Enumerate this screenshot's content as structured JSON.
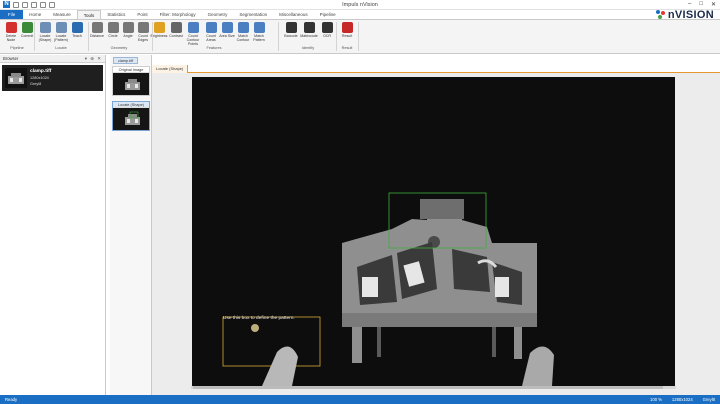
{
  "window": {
    "title": "Impuls nVision",
    "brand": "nVISION"
  },
  "menu": {
    "tabs": [
      {
        "label": "File"
      },
      {
        "label": "Home"
      },
      {
        "label": "Measure"
      },
      {
        "label": "Tools"
      },
      {
        "label": "Statistics"
      },
      {
        "label": "Point"
      },
      {
        "label": "Filter: Morphology"
      },
      {
        "label": "Geometry"
      },
      {
        "label": "Segmentation"
      },
      {
        "label": "Miscellaneous"
      },
      {
        "label": "Pipeline"
      }
    ],
    "active_tab": "Tools"
  },
  "ribbon": {
    "buttons": [
      {
        "label": "Delete Node",
        "icon": "delete-x-icon",
        "color": "#d32f2f"
      },
      {
        "label": "Commit",
        "icon": "commit-icon",
        "color": "#3a8a3a"
      },
      {
        "label": "Locate (Shape)",
        "icon": "locate-shape-icon",
        "color": "#6e8fb5"
      },
      {
        "label": "Locate (Pattern)",
        "icon": "locate-pattern-icon",
        "color": "#6e8fb5"
      },
      {
        "label": "Teach",
        "icon": "teach-icon",
        "color": "#2b6cb0"
      },
      {
        "label": "Distance",
        "icon": "distance-icon",
        "color": "#777777"
      },
      {
        "label": "Circle",
        "icon": "circle-icon",
        "color": "#777777"
      },
      {
        "label": "Angle",
        "icon": "angle-icon",
        "color": "#777777"
      },
      {
        "label": "Count Edges",
        "icon": "count-edges-icon",
        "color": "#777777"
      },
      {
        "label": "Brightness",
        "icon": "brightness-icon",
        "color": "#e0a020"
      },
      {
        "label": "Contrast",
        "icon": "contrast-icon",
        "color": "#666666"
      },
      {
        "label": "Count Contour Points",
        "icon": "contour-points-icon",
        "color": "#4a7fc1"
      },
      {
        "label": "Count Areas",
        "icon": "count-areas-icon",
        "color": "#4a7fc1"
      },
      {
        "label": "Area Size",
        "icon": "area-size-icon",
        "color": "#4a7fc1"
      },
      {
        "label": "Match Contour",
        "icon": "match-contour-icon",
        "color": "#4a7fc1"
      },
      {
        "label": "Match Pattern",
        "icon": "match-pattern-icon",
        "color": "#4a7fc1"
      },
      {
        "label": "Barcode",
        "icon": "barcode-icon",
        "color": "#333333"
      },
      {
        "label": "Matrixcode",
        "icon": "matrixcode-icon",
        "color": "#333333"
      },
      {
        "label": "OCR",
        "icon": "ocr-icon",
        "color": "#333333"
      },
      {
        "label": "Result",
        "icon": "result-icon",
        "color": "#c62828"
      }
    ],
    "groups": [
      {
        "label": "Pipeline"
      },
      {
        "label": "Locate"
      },
      {
        "label": "Geometry"
      },
      {
        "label": "Features"
      },
      {
        "label": "Identify"
      },
      {
        "label": "Result"
      }
    ]
  },
  "browser": {
    "title": "Browser",
    "item": {
      "name": "clamp.tiff",
      "size": "1280x1024",
      "format": "Greyl8"
    }
  },
  "pipeline": {
    "tab": "clamp.tiff",
    "steps": [
      {
        "label": "Original Image"
      },
      {
        "label": "Locate (Shape)"
      }
    ]
  },
  "view": {
    "tab": "Locate (Shape)",
    "tip": "Use this box to define the pattern."
  },
  "status": {
    "text": "Ready",
    "right": [
      "100 %",
      "1280x1024",
      "Greyl8"
    ]
  },
  "colors": {
    "accent": "#1a6fc4",
    "search_box": "#3fae3f",
    "pattern_box": "#d9a93a"
  }
}
